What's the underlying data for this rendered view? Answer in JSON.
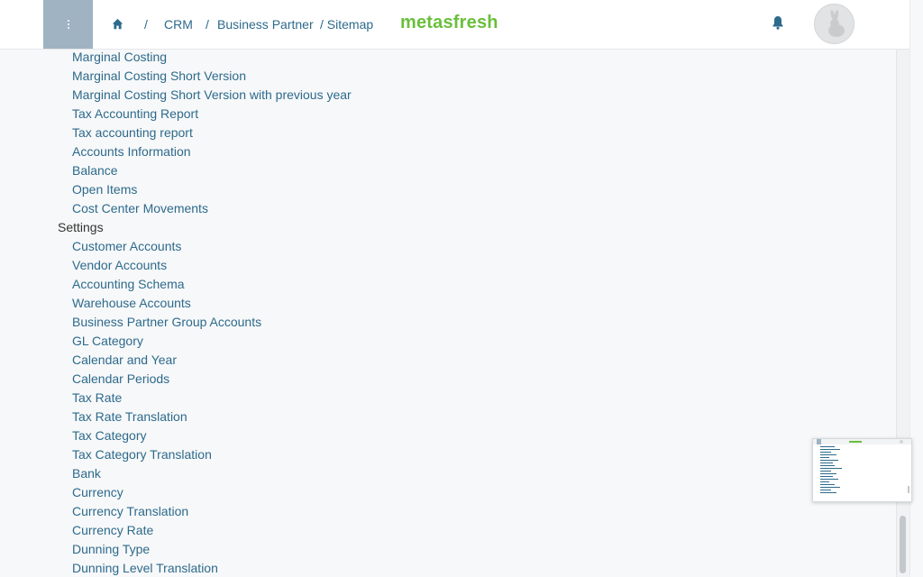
{
  "header": {
    "breadcrumb": {
      "sep": "/",
      "crm": "CRM",
      "business_partner": "Business Partner",
      "sitemap": "/ Sitemap"
    },
    "logo": "metasfresh"
  },
  "icons": {
    "menu": "menu-dots-icon",
    "home": "home-icon",
    "notifications": "bell-icon",
    "avatar": "rabbit-avatar"
  },
  "colors": {
    "link": "#2d6a8c",
    "brand": "#6abf3c",
    "menu_button": "#9fb3c2",
    "text": "#333333"
  },
  "sitemap": {
    "reports_items": [
      "Marginal Costing",
      "Marginal Costing Short Version",
      "Marginal Costing Short Version with previous year",
      "Tax Accounting Report",
      "Tax accounting report",
      "Accounts Information",
      "Balance",
      "Open Items",
      "Cost Center Movements"
    ],
    "settings_title": "Settings",
    "settings_items": [
      "Customer Accounts",
      "Vendor Accounts",
      "Accounting Schema",
      "Warehouse Accounts",
      "Business Partner Group Accounts",
      "GL Category",
      "Calendar and Year",
      "Calendar Periods",
      "Tax Rate",
      "Tax Rate Translation",
      "Tax Category",
      "Tax Category Translation",
      "Bank",
      "Currency",
      "Currency Translation",
      "Currency Rate",
      "Dunning Type",
      "Dunning Level Translation"
    ]
  }
}
